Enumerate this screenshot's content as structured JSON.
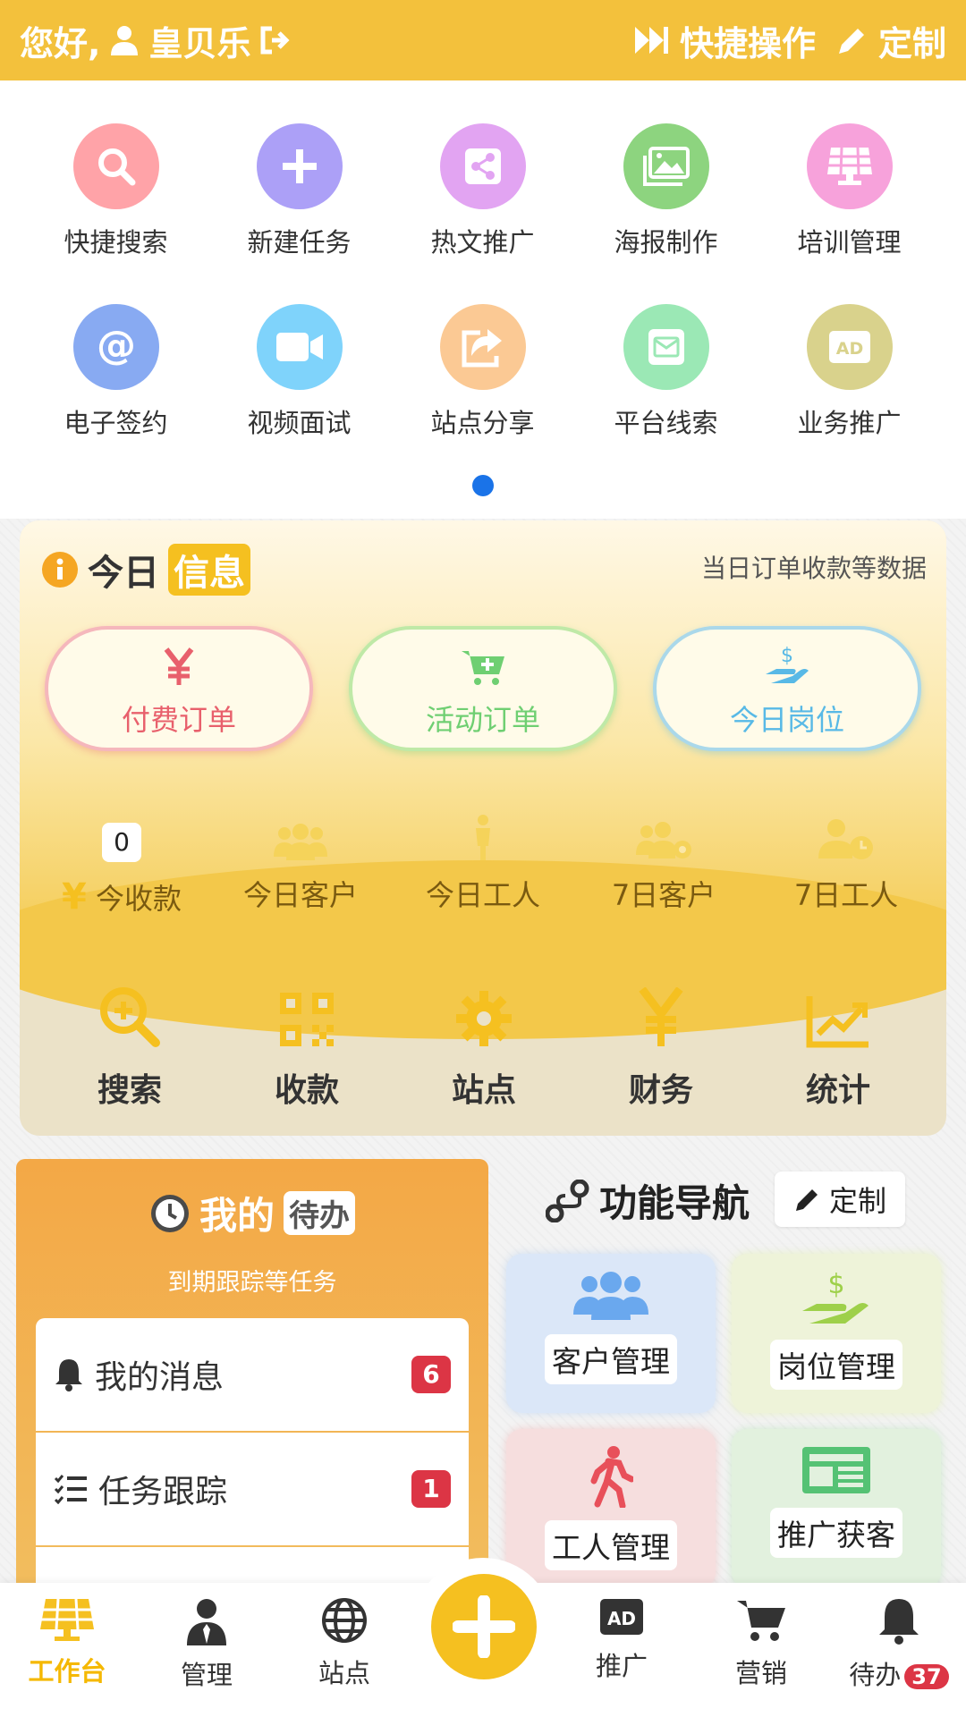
{
  "header": {
    "greeting": "您好,",
    "user": "皇贝乐",
    "quick_ops": "快捷操作",
    "customize": "定制"
  },
  "quick_actions": [
    {
      "label": "快捷搜索",
      "icon": "search-icon",
      "color": "#ffa3a8"
    },
    {
      "label": "新建任务",
      "icon": "plus-icon",
      "color": "#aca0f7"
    },
    {
      "label": "热文推广",
      "icon": "share-icon",
      "color": "#e2a4f2"
    },
    {
      "label": "海报制作",
      "icon": "image-icon",
      "color": "#8dd47f"
    },
    {
      "label": "培训管理",
      "icon": "solar-panel-icon",
      "color": "#f7a2db"
    },
    {
      "label": "电子签约",
      "icon": "at-icon",
      "color": "#88aaf2"
    },
    {
      "label": "视频面试",
      "icon": "video-icon",
      "color": "#7fd3fb"
    },
    {
      "label": "站点分享",
      "icon": "share-square-icon",
      "color": "#fbc994"
    },
    {
      "label": "平台线索",
      "icon": "envelope-icon",
      "color": "#9be8b5"
    },
    {
      "label": "业务推广",
      "icon": "ad-icon",
      "color": "#d9d28c"
    }
  ],
  "today": {
    "title_a": "今日",
    "title_b": "信息",
    "subtitle": "当日订单收款等数据",
    "pills": [
      {
        "label": "付费订单",
        "color": "#e8606c"
      },
      {
        "label": "活动订单",
        "color": "#6fcf72"
      },
      {
        "label": "今日岗位",
        "color": "#58b9e6"
      }
    ],
    "stats": [
      {
        "label": "今收款",
        "badge": "0"
      },
      {
        "label": "今日客户"
      },
      {
        "label": "今日工人"
      },
      {
        "label": "7日客户"
      },
      {
        "label": "7日工人"
      }
    ],
    "tools": [
      "搜索",
      "收款",
      "站点",
      "财务",
      "统计"
    ]
  },
  "todo": {
    "title_a": "我的",
    "title_b": "待办",
    "subtitle": "到期跟踪等任务",
    "items": [
      {
        "label": "我的消息",
        "count": "6"
      },
      {
        "label": "任务跟踪",
        "count": "1"
      }
    ]
  },
  "nav_func": {
    "title": "功能导航",
    "customize": "定制",
    "cards": [
      {
        "label": "客户管理",
        "bg": "#dbe7f8"
      },
      {
        "label": "岗位管理",
        "bg": "#eef3d9"
      },
      {
        "label": "工人管理",
        "bg": "#f6dede"
      },
      {
        "label": "推广获客",
        "bg": "#e2f1de"
      }
    ]
  },
  "bottom_nav": [
    {
      "label": "工作台",
      "active": true
    },
    {
      "label": "管理"
    },
    {
      "label": "站点"
    },
    {
      "label": "推广"
    },
    {
      "label": "营销"
    },
    {
      "label": "待办",
      "badge": "37"
    }
  ],
  "colors": {
    "primary": "#f3c13c",
    "accent_blue": "#1a73e8",
    "badge_red": "#dc3545"
  }
}
